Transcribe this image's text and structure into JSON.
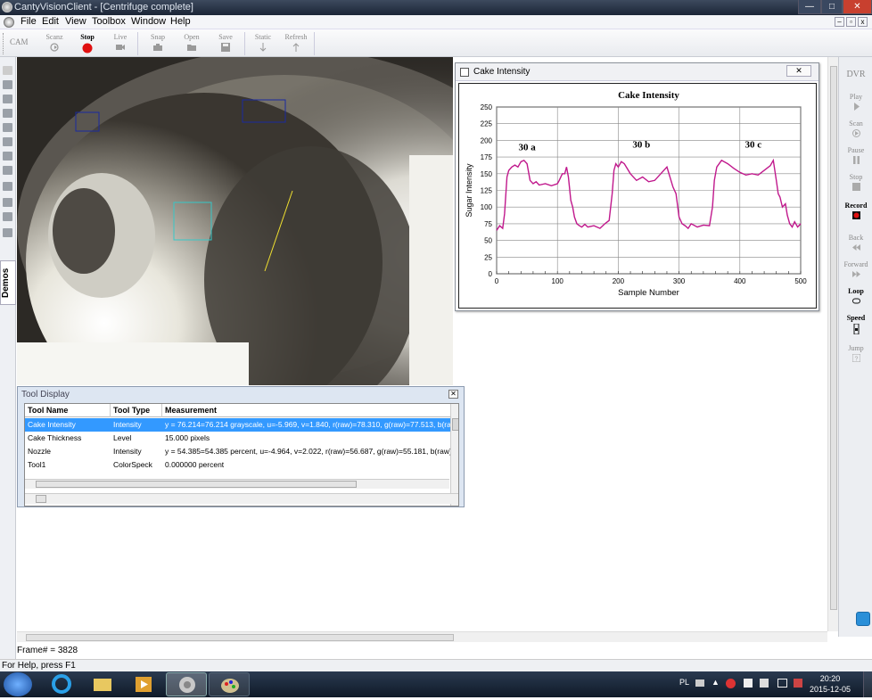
{
  "window": {
    "title": "CantyVisionClient - [Centrifuge complete]"
  },
  "menu": [
    "File",
    "Edit",
    "View",
    "Toolbox",
    "Window",
    "Help"
  ],
  "toolbar": {
    "cam": "CAM",
    "items": [
      {
        "label": "Scanz",
        "icon": "scan-icon"
      },
      {
        "label": "Stop",
        "icon": "stop-icon",
        "active": true
      },
      {
        "label": "Live",
        "icon": "camera-icon"
      },
      {
        "label": "Snap",
        "icon": "snap-icon"
      },
      {
        "label": "Open",
        "icon": "open-folder-icon"
      },
      {
        "label": "Save",
        "icon": "save-icon"
      },
      {
        "label": "Static",
        "icon": "arrow-down-icon"
      },
      {
        "label": "Refresh",
        "icon": "arrow-up-icon"
      }
    ]
  },
  "side_tab": "Demos",
  "chart_window": {
    "title": "Cake Intensity"
  },
  "chart_data": {
    "type": "line",
    "title": "Cake Intensity",
    "xlabel": "Sample Number",
    "ylabel": "Sugar Intensity",
    "xlim": [
      0,
      500
    ],
    "ylim": [
      0,
      250
    ],
    "xticks": [
      0,
      100,
      200,
      300,
      400,
      500
    ],
    "yticks": [
      0,
      25,
      50,
      75,
      100,
      125,
      150,
      175,
      200,
      225,
      250
    ],
    "grid": true,
    "color": "#c0188c",
    "annotations": [
      {
        "text": "30 a",
        "x": 50,
        "y": 185
      },
      {
        "text": "30 b",
        "x": 238,
        "y": 189
      },
      {
        "text": "30 c",
        "x": 422,
        "y": 189
      }
    ],
    "x": [
      0,
      5,
      10,
      13,
      17,
      20,
      25,
      30,
      35,
      40,
      45,
      50,
      55,
      60,
      65,
      70,
      80,
      90,
      100,
      103,
      108,
      112,
      115,
      118,
      122,
      125,
      128,
      132,
      136,
      140,
      145,
      150,
      160,
      170,
      178,
      185,
      190,
      193,
      196,
      200,
      205,
      210,
      220,
      230,
      240,
      250,
      260,
      270,
      280,
      290,
      295,
      300,
      305,
      310,
      315,
      320,
      330,
      340,
      350,
      355,
      358,
      362,
      366,
      370,
      380,
      390,
      400,
      410,
      420,
      430,
      440,
      450,
      455,
      460,
      463,
      466,
      470,
      475,
      478,
      482,
      486,
      490,
      495,
      500
    ],
    "y": [
      65,
      72,
      68,
      90,
      145,
      155,
      160,
      163,
      160,
      168,
      170,
      165,
      140,
      135,
      138,
      133,
      135,
      132,
      135,
      140,
      150,
      150,
      160,
      145,
      110,
      100,
      85,
      75,
      72,
      70,
      74,
      70,
      72,
      68,
      75,
      80,
      120,
      155,
      165,
      160,
      168,
      165,
      150,
      140,
      145,
      138,
      140,
      150,
      160,
      130,
      120,
      85,
      75,
      72,
      68,
      75,
      70,
      73,
      72,
      100,
      140,
      160,
      165,
      170,
      165,
      158,
      152,
      148,
      150,
      148,
      155,
      162,
      170,
      140,
      120,
      115,
      100,
      105,
      88,
      75,
      70,
      78,
      70,
      75
    ]
  },
  "tool_display": {
    "title": "Tool Display",
    "columns": [
      "Tool Name",
      "Tool Type",
      "Measurement"
    ],
    "rows": [
      {
        "name": "Cake Intensity",
        "type": "Intensity",
        "measurement": "y = 76.214=76.214 grayscale, u=-5.969, v=1.840, r(raw)=78.310, g(raw)=77.513, b(raw)=",
        "selected": true
      },
      {
        "name": "Cake Thickness",
        "type": "Level",
        "measurement": "15.000 pixels"
      },
      {
        "name": "Nozzle",
        "type": "Intensity",
        "measurement": "y = 54.385=54.385 percent, u=-4.964, v=2.022, r(raw)=56.687, g(raw)=55.181, b(raw)=4"
      },
      {
        "name": "Tool1",
        "type": "ColorSpeck",
        "measurement": "0.000000 percent"
      }
    ]
  },
  "dvr": {
    "title": "DVR",
    "items": [
      {
        "label": "Play",
        "bold": false
      },
      {
        "label": "Scan",
        "bold": false
      },
      {
        "label": "Pause",
        "bold": false
      },
      {
        "label": "Stop",
        "bold": false
      },
      {
        "label": "Record",
        "bold": true
      },
      {
        "label": "Back",
        "bold": false
      },
      {
        "label": "Forward",
        "bold": false
      },
      {
        "label": "Loop",
        "bold": true
      },
      {
        "label": "Speed",
        "bold": true
      },
      {
        "label": "Jump",
        "bold": false
      }
    ]
  },
  "frame_text": "Frame# = 3828",
  "status_text": "For Help, press F1",
  "taskbar": {
    "lang": "PL",
    "time": "20:20",
    "date": "2015-12-05"
  }
}
